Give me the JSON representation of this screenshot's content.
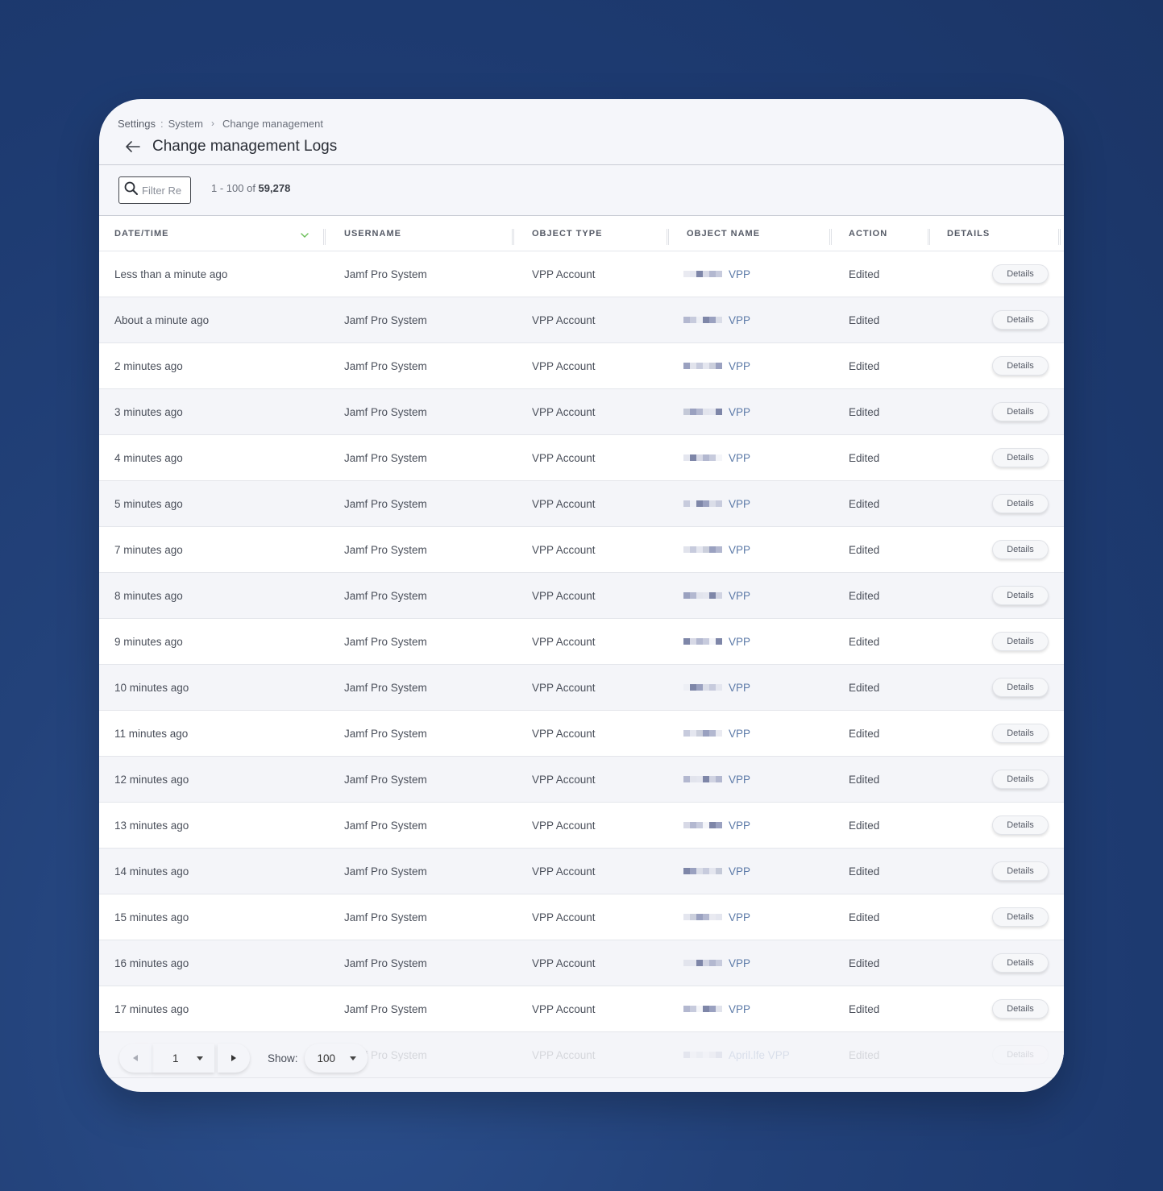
{
  "breadcrumb": {
    "root": "Settings",
    "separator": ":",
    "section": "System",
    "current": "Change management"
  },
  "page_title": "Change management Logs",
  "filter": {
    "placeholder": "Filter Re"
  },
  "count": {
    "range": "1 - 100 of ",
    "total": "59,278"
  },
  "columns": [
    "DATE/TIME",
    "USERNAME",
    "OBJECT TYPE",
    "OBJECT NAME",
    "ACTION",
    "DETAILS"
  ],
  "rows": [
    {
      "date": "Less than a minute ago",
      "user": "Jamf Pro System",
      "type": "VPP Account",
      "name": "VPP",
      "action": "Edited",
      "details": "Details"
    },
    {
      "date": "About a minute ago",
      "user": "Jamf Pro System",
      "type": "VPP Account",
      "name": "VPP",
      "action": "Edited",
      "details": "Details"
    },
    {
      "date": "2 minutes ago",
      "user": "Jamf Pro System",
      "type": "VPP Account",
      "name": "VPP",
      "action": "Edited",
      "details": "Details"
    },
    {
      "date": "3 minutes ago",
      "user": "Jamf Pro System",
      "type": "VPP Account",
      "name": "VPP",
      "action": "Edited",
      "details": "Details"
    },
    {
      "date": "4 minutes ago",
      "user": "Jamf Pro System",
      "type": "VPP Account",
      "name": "VPP",
      "action": "Edited",
      "details": "Details"
    },
    {
      "date": "5 minutes ago",
      "user": "Jamf Pro System",
      "type": "VPP Account",
      "name": "VPP",
      "action": "Edited",
      "details": "Details"
    },
    {
      "date": "7 minutes ago",
      "user": "Jamf Pro System",
      "type": "VPP Account",
      "name": "VPP",
      "action": "Edited",
      "details": "Details"
    },
    {
      "date": "8 minutes ago",
      "user": "Jamf Pro System",
      "type": "VPP Account",
      "name": "VPP",
      "action": "Edited",
      "details": "Details"
    },
    {
      "date": "9 minutes ago",
      "user": "Jamf Pro System",
      "type": "VPP Account",
      "name": "VPP",
      "action": "Edited",
      "details": "Details"
    },
    {
      "date": "10 minutes ago",
      "user": "Jamf Pro System",
      "type": "VPP Account",
      "name": "VPP",
      "action": "Edited",
      "details": "Details"
    },
    {
      "date": "11 minutes ago",
      "user": "Jamf Pro System",
      "type": "VPP Account",
      "name": "VPP",
      "action": "Edited",
      "details": "Details"
    },
    {
      "date": "12 minutes ago",
      "user": "Jamf Pro System",
      "type": "VPP Account",
      "name": "VPP",
      "action": "Edited",
      "details": "Details"
    },
    {
      "date": "13 minutes ago",
      "user": "Jamf Pro System",
      "type": "VPP Account",
      "name": "VPP",
      "action": "Edited",
      "details": "Details"
    },
    {
      "date": "14 minutes ago",
      "user": "Jamf Pro System",
      "type": "VPP Account",
      "name": "VPP",
      "action": "Edited",
      "details": "Details"
    },
    {
      "date": "15 minutes ago",
      "user": "Jamf Pro System",
      "type": "VPP Account",
      "name": "VPP",
      "action": "Edited",
      "details": "Details"
    },
    {
      "date": "16 minutes ago",
      "user": "Jamf Pro System",
      "type": "VPP Account",
      "name": "VPP",
      "action": "Edited",
      "details": "Details"
    },
    {
      "date": "17 minutes ago",
      "user": "Jamf Pro System",
      "type": "VPP Account",
      "name": "VPP",
      "action": "Edited",
      "details": "Details"
    },
    {
      "date": "",
      "user": "Jamf Pro System",
      "type": "VPP Account",
      "name": "April.lfe VPP",
      "action": "Edited",
      "details": "Details"
    }
  ],
  "pager": {
    "page": "1",
    "show_label": "Show:",
    "page_size": "100"
  },
  "colors": {
    "accent": "#5c7aa8",
    "sort_indicator": "#6bbf59",
    "background": "#1f3d73"
  },
  "icons": {
    "search": "search-icon",
    "back": "arrow-left-icon",
    "sort": "chevron-down-icon",
    "prev": "triangle-left-icon",
    "next": "triangle-right-icon",
    "dropdown": "caret-down-icon"
  }
}
